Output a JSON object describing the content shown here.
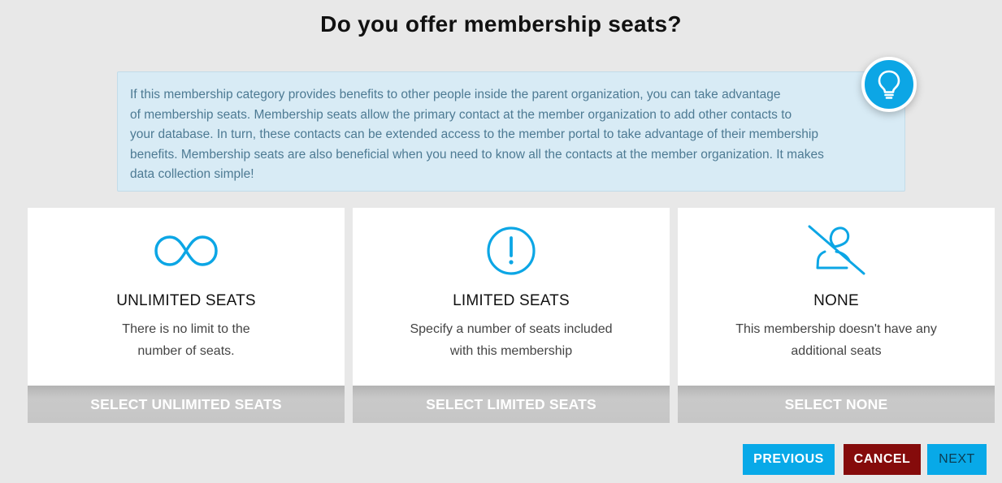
{
  "page": {
    "title": "Do you offer membership seats?"
  },
  "info": {
    "lines": [
      "If this membership category provides benefits to other people inside the parent organization, you can take advantage",
      "of membership seats. Membership seats allow the primary contact at the member organization to add other contacts to",
      "your database. In turn, these contacts can be extended access to the member portal to take advantage of their membership",
      "benefits. Membership seats are also beneficial when you need to know all the contacts at the member organization. It makes",
      "data collection simple!"
    ],
    "icon": "lightbulb-icon"
  },
  "options": [
    {
      "icon": "infinity-icon",
      "title": "UNLIMITED SEATS",
      "desc_lines": [
        "There is no limit to the",
        "number of seats."
      ],
      "button": "SELECT UNLIMITED SEATS"
    },
    {
      "icon": "exclamation-circle-icon",
      "title": "LIMITED SEATS",
      "desc_lines": [
        "Specify a number of seats included",
        "with this membership"
      ],
      "button": "SELECT LIMITED SEATS"
    },
    {
      "icon": "no-user-icon",
      "title": "NONE",
      "desc_lines": [
        "This membership doesn't have any",
        "additional seats"
      ],
      "button": "SELECT NONE"
    }
  ],
  "nav": {
    "previous": "PREVIOUS",
    "cancel": "CANCEL",
    "next": "NEXT"
  },
  "colors": {
    "accent": "#0ca6e5",
    "cancel": "#850b0b",
    "info_bg": "#d8ebf5",
    "info_text": "#4d7a93",
    "select_button": "#c6c6c6"
  }
}
